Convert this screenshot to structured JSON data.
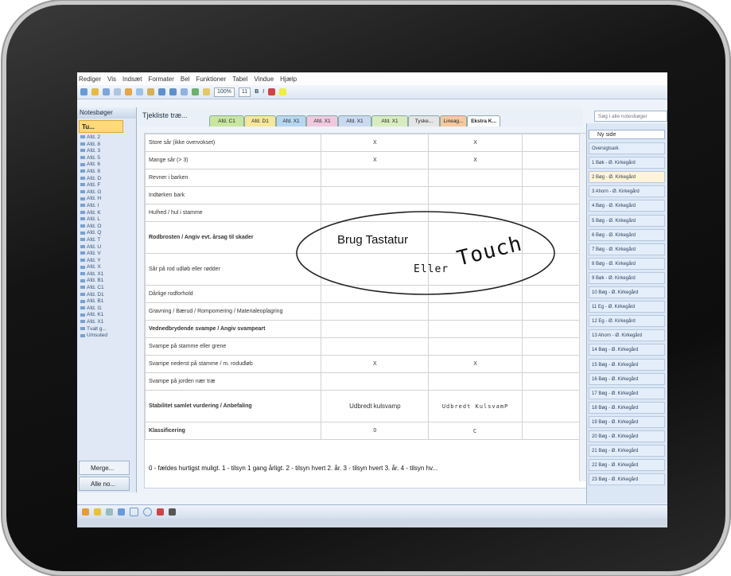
{
  "menu": [
    "Rediger",
    "Vis",
    "Indsæt",
    "Formater",
    "Bel",
    "Funktioner",
    "Tabel",
    "Vindue",
    "Hjælp"
  ],
  "toolbar": {
    "zoom": "100%",
    "font_size": "11"
  },
  "navpane": {
    "header": "Notesbøger",
    "selected_notebook": "Tu...",
    "sections": [
      "Afd. 2",
      "Afd. 8",
      "Afd. 3",
      "Afd. 5",
      "Afd. 6",
      "Afd. 8",
      "Afd. D",
      "Afd. F",
      "Afd. G",
      "Afd. H",
      "Afd. I",
      "Afd. K",
      "Afd. L",
      "Afd. O",
      "Afd. Q",
      "Afd. T",
      "Afd. U",
      "Afd. V",
      "Afd. Y",
      "Afd. X",
      "Afd. X1",
      "Afd. B1",
      "Afd. C1",
      "Afd. D1",
      "Afd. B1",
      "Afd. I1",
      "Afd. K1",
      "Afd. X1",
      "Tvalt g...",
      "Umsuted"
    ],
    "merge_label": "Merge...",
    "all_notebooks_label": "Alle no..."
  },
  "page_title": "Tjekliste træ...",
  "tabs": [
    "Afd. C1",
    "Afd. D1",
    "Afd. X1",
    "Afd. X1",
    "Afd. X1",
    "Afd. X1",
    "Tyske...",
    "Lineag...",
    "Ekstra K..."
  ],
  "search_placeholder": "Søg i alle notesbøger",
  "rows": [
    {
      "label": "Store sår (ikke overvokset)",
      "a": "X",
      "b": "X"
    },
    {
      "label": "Mange sår (> 3)",
      "a": "X",
      "b": "X"
    },
    {
      "label": "Revner i barken",
      "a": "",
      "b": ""
    },
    {
      "label": "Indtørken bark",
      "a": "",
      "b": ""
    },
    {
      "label": "Hulhed / hul i stamme",
      "a": "",
      "b": ""
    },
    {
      "label": "Rodbrosten / Angiv evt. årsag til skader",
      "a": "Brug Tastatur",
      "b": ""
    },
    {
      "label": "Sår på rod udløb eller rødder",
      "a": "",
      "b": "Eller Touch"
    },
    {
      "label": "Dårlige rodforhold",
      "a": "",
      "b": ""
    },
    {
      "label": "Gravning / Bærud / Rompomering / Materialeoplagring",
      "a": "",
      "b": ""
    },
    {
      "label": "Vednedbrydende svampe / Angiv svampeart",
      "a": "",
      "b": ""
    },
    {
      "label": "Svampe på stamme eller grene",
      "a": "",
      "b": ""
    },
    {
      "label": "Svampe nederst på stamme / m. rodudløb",
      "a": "X",
      "b": "X"
    },
    {
      "label": "Svampe på jorden nær træ",
      "a": "",
      "b": ""
    },
    {
      "label": "Stabilitet samlet vurdering / Anbefaling",
      "a": "Udbredt kulsvamp",
      "b": "Udbredt KulsvamP"
    },
    {
      "label": "Klassificering",
      "a": "0",
      "b": "C"
    }
  ],
  "annotation": {
    "typed": "Brug Tastatur",
    "hand1": "Eller",
    "hand2": "Touch"
  },
  "legend": "0 - fældes hurtigst muligt. 1 - tilsyn 1 gang årligt. 2 - tilsyn hvert 2. år. 3 - tilsyn hvert 3. år. 4 - tilsyn hv...",
  "pagelist": {
    "header": "Ny side",
    "items": [
      "Oversigtsark",
      "1 Bøk - Ø. Kirkegård",
      "2 Bøg - Ø. Kirkegård",
      "3 Ahorn - Ø. Kirkegård",
      "4 Bøg - Ø. Kirkegård",
      "5 Bøg - Ø. Kirkegård",
      "6 Bøg - Ø. Kirkegård",
      "7 Bøg - Ø. Kirkegård",
      "8 Bøg - Ø. Kirkegård",
      "9 Bøk - Ø. Kirkegård",
      "10 Bøg - Ø. Kirkegård",
      "11 Eg - Ø. Kirkegård",
      "12 Eg - Ø. Kirkegård",
      "13 Ahorn - Ø. Kirkegård",
      "14 Bøg - Ø. Kirkegård",
      "15 Bøg - Ø. Kirkegård",
      "16 Bøg - Ø. Kirkegård",
      "17 Bøg - Ø. Kirkegård",
      "18 Bøg - Ø. Kirkegård",
      "19 Bøg - Ø. Kirkegård",
      "20 Bøg - Ø. Kirkegård",
      "21 Bøg - Ø. Kirkegård",
      "22 Bøg - Ø. Kirkegård",
      "23 Bøg - Ø. Kirkegård"
    ],
    "selected_index": 2
  },
  "colors": {
    "tab_colors": [
      "#c9e6a0",
      "#f6e79a",
      "#b7d7f0",
      "#f0c9e0",
      "#c9d9f0",
      "#d9ecc0",
      "#e5e5e5",
      "#f5c9a0",
      "#d7e6c2"
    ]
  }
}
